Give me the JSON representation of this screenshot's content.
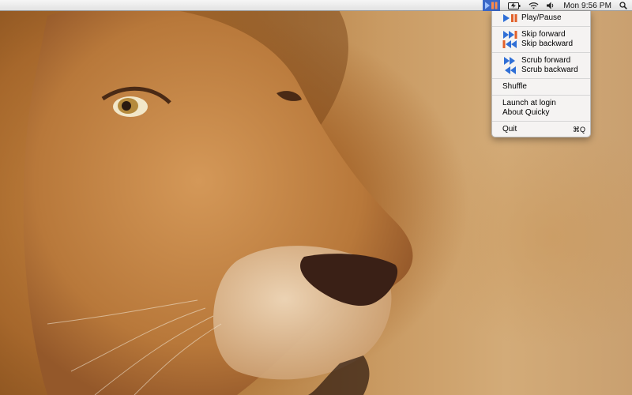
{
  "menubar": {
    "clock": "Mon 9:56 PM",
    "icons": [
      "quicky-menu-icon",
      "battery-icon",
      "wifi-icon",
      "volume-icon",
      "spotlight-icon"
    ]
  },
  "quicky_menu": {
    "play_pause": "Play/Pause",
    "skip_forward": "Skip forward",
    "skip_backward": "Skip backward",
    "scrub_forward": "Scrub forward",
    "scrub_backward": "Scrub backward",
    "shuffle": "Shuffle",
    "launch_at_login": "Launch at login",
    "about": "About Quicky",
    "quit": "Quit",
    "quit_shortcut": "⌘Q"
  },
  "colors": {
    "menu_icon_blue": "#2f6fd6",
    "menu_icon_orange": "#e2602a",
    "menubar_highlight": "#3b68c8"
  },
  "wallpaper": "lion-wallpaper"
}
